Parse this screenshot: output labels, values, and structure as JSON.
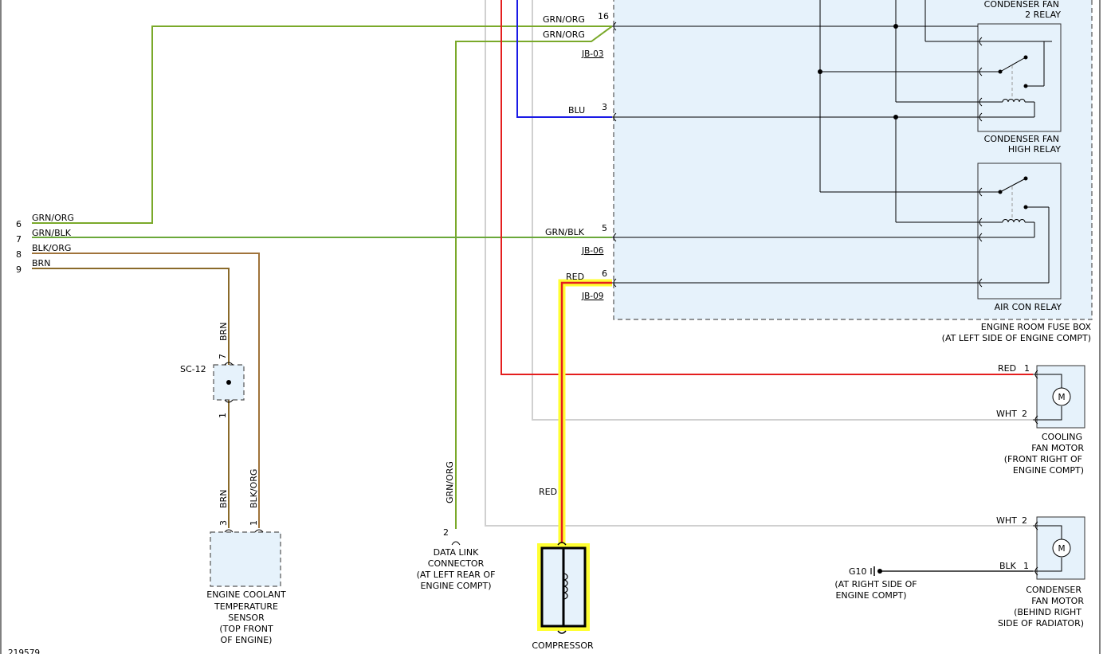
{
  "colors": {
    "grn_org": "#7aa92a",
    "grn_blk": "#6aa83a",
    "blk_org": "#a0733a",
    "brn": "#8a6a2a",
    "red": "#e41e1e",
    "blu": "#1a1ae6",
    "wht": "#d0d0d0",
    "highlight": "#ffff33",
    "box_fill": "#e6f2fb"
  },
  "wires": {
    "grn_org": "GRN/ORG",
    "grn_blk": "GRN/BLK",
    "blk_org": "BLK/ORG",
    "brn": "BRN",
    "blu": "BLU",
    "red": "RED",
    "wht": "WHT",
    "blk": "BLK"
  },
  "left_pins": [
    "6",
    "7",
    "8",
    "9"
  ],
  "fuse_box": {
    "name": "ENGINE ROOM FUSE BOX",
    "location": "(AT LEFT SIDE OF ENGINE COMPT)",
    "pins": {
      "p16": "16",
      "p3": "3",
      "p5": "5",
      "p6": "6"
    },
    "connectors": {
      "jb03": "JB-03",
      "jb06": "JB-06",
      "jb09": "JB-09"
    }
  },
  "relays": {
    "fan2_line1": "CONDENSER FAN",
    "fan2_line2": "2 RELAY",
    "high_line1": "CONDENSER FAN",
    "high_line2": "HIGH RELAY",
    "aircon": "AIR CON RELAY"
  },
  "sc12": {
    "name": "SC-12",
    "pin_top": "7",
    "pin_bottom": "1"
  },
  "coolant_sensor": {
    "pin3": "3",
    "pin1": "1",
    "lines": [
      "ENGINE COOLANT",
      "TEMPERATURE",
      "SENSOR",
      "(TOP FRONT",
      "OF ENGINE)"
    ]
  },
  "data_link": {
    "pin": "2",
    "lines": [
      "DATA LINK",
      "CONNECTOR",
      "(AT LEFT REAR OF",
      "ENGINE COMPT)"
    ]
  },
  "compressor": {
    "label": "COMPRESSOR"
  },
  "cooling_fan_motor": {
    "pin1": "1",
    "pin2": "2",
    "symbol": "M",
    "lines": [
      "COOLING",
      "FAN MOTOR",
      "(FRONT RIGHT OF",
      "ENGINE COMPT)"
    ]
  },
  "condenser_fan_motor": {
    "pin2": "2",
    "pin1": "1",
    "symbol": "M",
    "lines": [
      "CONDENSER",
      "FAN MOTOR",
      "(BEHIND RIGHT",
      "SIDE OF RADIATOR)"
    ]
  },
  "ground": {
    "name": "G10",
    "lines": [
      "(AT RIGHT SIDE OF",
      "ENGINE COMPT)"
    ]
  },
  "figure_id": "219579"
}
